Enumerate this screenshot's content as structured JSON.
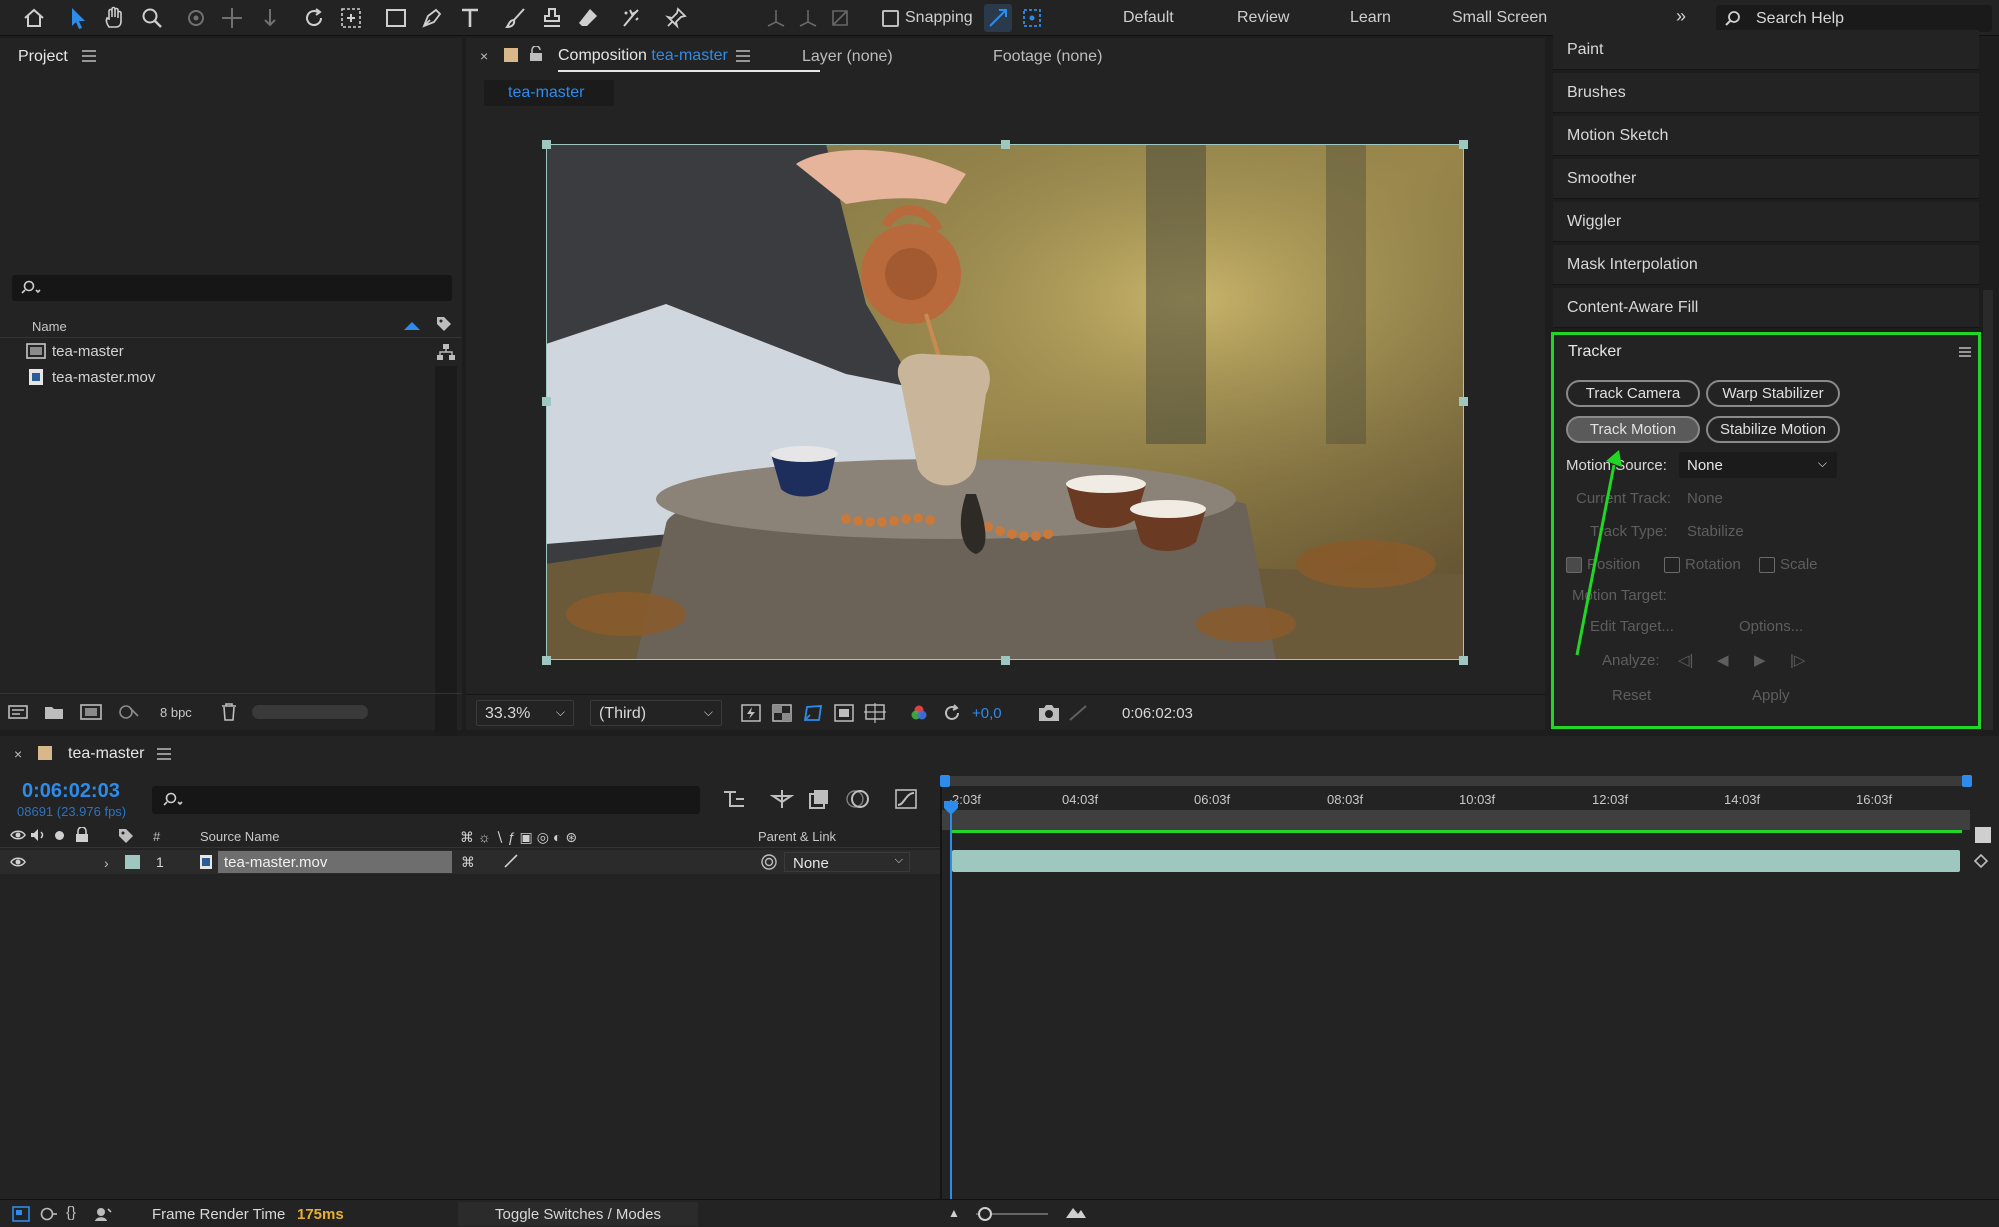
{
  "toolbar": {
    "snapping_label": "Snapping",
    "workspaces": [
      "Default",
      "Review",
      "Learn",
      "Small Screen"
    ],
    "search_placeholder": "Search Help"
  },
  "project": {
    "title": "Project",
    "column_name": "Name",
    "items": [
      {
        "name": "tea-master",
        "type": "composition-icon"
      },
      {
        "name": "tea-master.mov",
        "type": "footage-icon"
      }
    ],
    "bpc": "8 bpc"
  },
  "viewer": {
    "tab_prefix": "Composition",
    "tab_comp_name": "tea-master",
    "tab_layer": "Layer (none)",
    "tab_footage": "Footage (none)",
    "breadcrumb": "tea-master",
    "zoom": "33.3%",
    "resolution": "(Third)",
    "exposure": "+0,0",
    "timecode": "0:06:02:03"
  },
  "right_panels": [
    "Paint",
    "Brushes",
    "Motion Sketch",
    "Smoother",
    "Wiggler",
    "Mask Interpolation",
    "Content-Aware Fill"
  ],
  "tracker": {
    "title": "Tracker",
    "track_camera": "Track Camera",
    "warp_stabilizer": "Warp Stabilizer",
    "track_motion": "Track Motion",
    "stabilize_motion": "Stabilize Motion",
    "motion_source_label": "Motion Source:",
    "motion_source_value": "None",
    "current_track_label": "Current Track:",
    "current_track_value": "None",
    "track_type_label": "Track Type:",
    "track_type_value": "Stabilize",
    "position": "Position",
    "rotation": "Rotation",
    "scale": "Scale",
    "motion_target": "Motion Target:",
    "edit_target": "Edit Target...",
    "options": "Options...",
    "analyze": "Analyze:",
    "reset": "Reset",
    "apply": "Apply"
  },
  "timeline": {
    "comp_name": "tea-master",
    "timecode": "0:06:02:03",
    "frame_info": "08691 (23.976 fps)",
    "col_hash": "#",
    "col_source": "Source Name",
    "col_parent": "Parent & Link",
    "layers": [
      {
        "num": "1",
        "name": "tea-master.mov",
        "parent": "None"
      }
    ],
    "ruler": [
      "2:03f",
      "04:03f",
      "06:03f",
      "08:03f",
      "10:03f",
      "12:03f",
      "14:03f",
      "16:03f"
    ]
  },
  "status": {
    "frame_render_label": "Frame Render Time",
    "frame_render_value": "175ms",
    "toggle_label": "Toggle Switches / Modes"
  },
  "colors": {
    "accent": "#2d8ceb",
    "highlight": "#22d626",
    "render_time": "#e8b030",
    "clip": "#9ec7c0"
  }
}
